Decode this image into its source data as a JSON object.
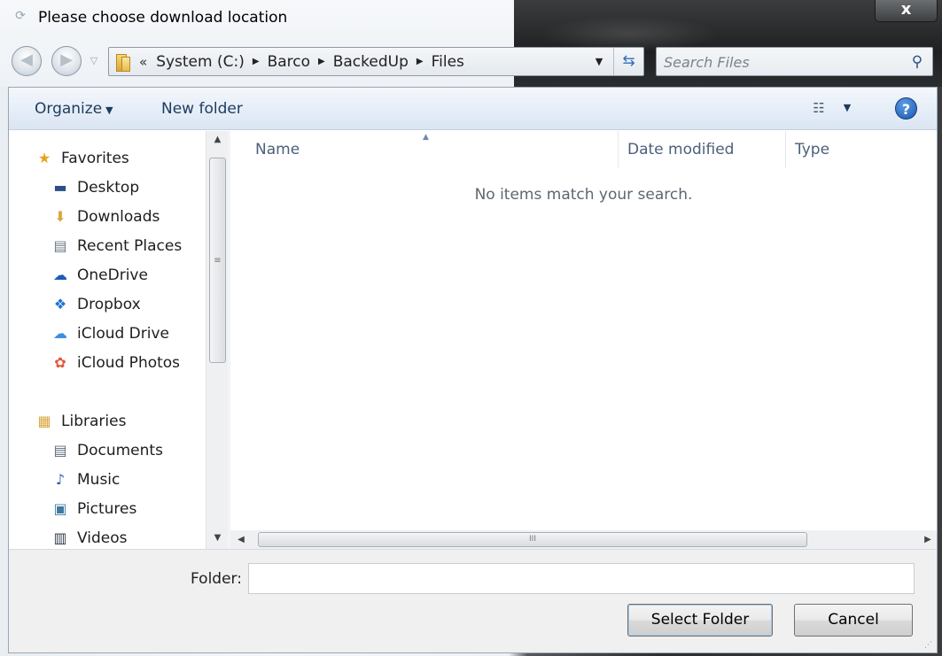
{
  "window": {
    "title": "Please choose download location",
    "close_label": "x"
  },
  "nav": {
    "back_icon": "arrow-left-icon",
    "forward_icon": "arrow-right-icon"
  },
  "address": {
    "overflow": "«",
    "crumbs": [
      "System (C:)",
      "Barco",
      "BackedUp",
      "Files"
    ]
  },
  "search": {
    "placeholder": "Search Files"
  },
  "toolbar": {
    "organize_label": "Organize",
    "new_folder_label": "New folder"
  },
  "sidebar": {
    "favorites": {
      "label": "Favorites",
      "items": [
        {
          "label": "Desktop",
          "icon": "desktop-icon"
        },
        {
          "label": "Downloads",
          "icon": "downloads-icon"
        },
        {
          "label": "Recent Places",
          "icon": "recent-places-icon"
        },
        {
          "label": "OneDrive",
          "icon": "onedrive-icon"
        },
        {
          "label": "Dropbox",
          "icon": "dropbox-icon"
        },
        {
          "label": "iCloud Drive",
          "icon": "icloud-drive-icon"
        },
        {
          "label": "iCloud Photos",
          "icon": "icloud-photos-icon"
        }
      ]
    },
    "libraries": {
      "label": "Libraries",
      "items": [
        {
          "label": "Documents",
          "icon": "documents-icon"
        },
        {
          "label": "Music",
          "icon": "music-icon"
        },
        {
          "label": "Pictures",
          "icon": "pictures-icon"
        },
        {
          "label": "Videos",
          "icon": "videos-icon"
        }
      ]
    }
  },
  "filelist": {
    "columns": [
      "Name",
      "Date modified",
      "Type"
    ],
    "empty_message": "No items match your search."
  },
  "footer": {
    "folder_label": "Folder:",
    "folder_value": "",
    "select_label": "Select Folder",
    "cancel_label": "Cancel"
  },
  "colors": {
    "accent": "#2f6cb8",
    "toolbar_text": "#1e3b5f",
    "header_text": "#4c607a"
  }
}
